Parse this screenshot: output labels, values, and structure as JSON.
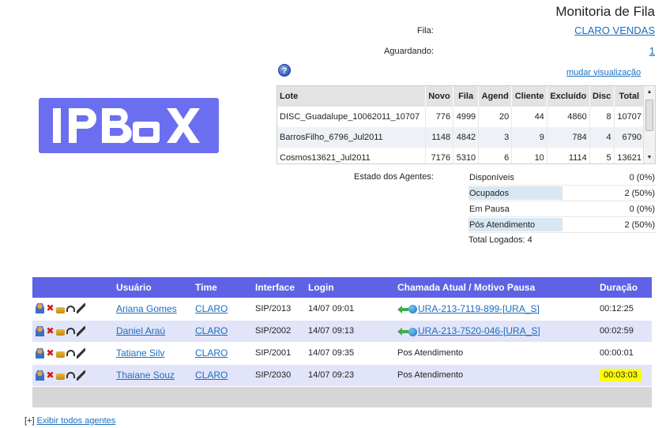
{
  "header": {
    "title": "Monitoria de Fila",
    "fila_label": "Fila:",
    "fila_value": "CLARO VENDAS",
    "aguardando_label": "Aguardando:",
    "aguardando_value": "1",
    "mudar_link": "mudar visualização",
    "help_glyph": "?"
  },
  "logo": {
    "text": "IPBOX",
    "color": "#6c6ef0"
  },
  "lotes": {
    "columns": [
      "Lote",
      "Novo",
      "Fila",
      "Agend",
      "Cliente",
      "Excluído",
      "Disc",
      "Total"
    ],
    "rows": [
      [
        "DISC_Guadalupe_10062011_10707",
        "776",
        "4999",
        "20",
        "44",
        "4860",
        "8",
        "10707"
      ],
      [
        "BarrosFilho_6796_Jul2011",
        "1148",
        "4842",
        "3",
        "9",
        "784",
        "4",
        "6790"
      ],
      [
        "Cosmos13621_Jul2011",
        "7176",
        "5310",
        "6",
        "10",
        "1114",
        "5",
        "13621"
      ]
    ]
  },
  "estado": {
    "label": "Estado dos Agentes:",
    "items": [
      {
        "name": "Disponíveis",
        "value": "0 (0%)",
        "fraction": 0
      },
      {
        "name": "Ocupados",
        "value": "2 (50%)",
        "fraction": 0.5
      },
      {
        "name": "Em Pausa",
        "value": "0 (0%)",
        "fraction": 0
      },
      {
        "name": "Pós Atendimento",
        "value": "2 (50%)",
        "fraction": 0.5
      }
    ],
    "total": "Total Logados: 4"
  },
  "agents": {
    "columns": [
      "",
      "Usuário",
      "Time",
      "Interface",
      "Login",
      "Chamada Atual / Motivo Pausa",
      "Duração"
    ],
    "rows": [
      {
        "user": "Ariana Gomes",
        "team": "CLARO",
        "interface": "SIP/2013",
        "login": "14/07 09:01",
        "call": "URA-213-7119-899-[URA_S]",
        "call_is_link": true,
        "duration": "00:12:25",
        "highlight": false
      },
      {
        "user": "Daniel Araú",
        "team": "CLARO",
        "interface": "SIP/2002",
        "login": "14/07 09:13",
        "call": "URA-213-7520-046-[URA_S]",
        "call_is_link": true,
        "duration": "00:02:59",
        "highlight": false
      },
      {
        "user": "Tatiane Silv",
        "team": "CLARO",
        "interface": "SIP/2001",
        "login": "14/07 09:35",
        "call": "Pos Atendimento",
        "call_is_link": false,
        "duration": "00:00:01",
        "highlight": false
      },
      {
        "user": "Thaiane Souz",
        "team": "CLARO",
        "interface": "SIP/2030",
        "login": "14/07 09:23",
        "call": "Pos Atendimento",
        "call_is_link": false,
        "duration": "00:03:03",
        "highlight": true
      }
    ],
    "header_color": "#5e62e4",
    "alt_row_color": "#e2e4f9",
    "highlight_color": "#ffff00"
  },
  "footer": {
    "bracket": "[+]",
    "link": "Exibir todos agentes"
  }
}
